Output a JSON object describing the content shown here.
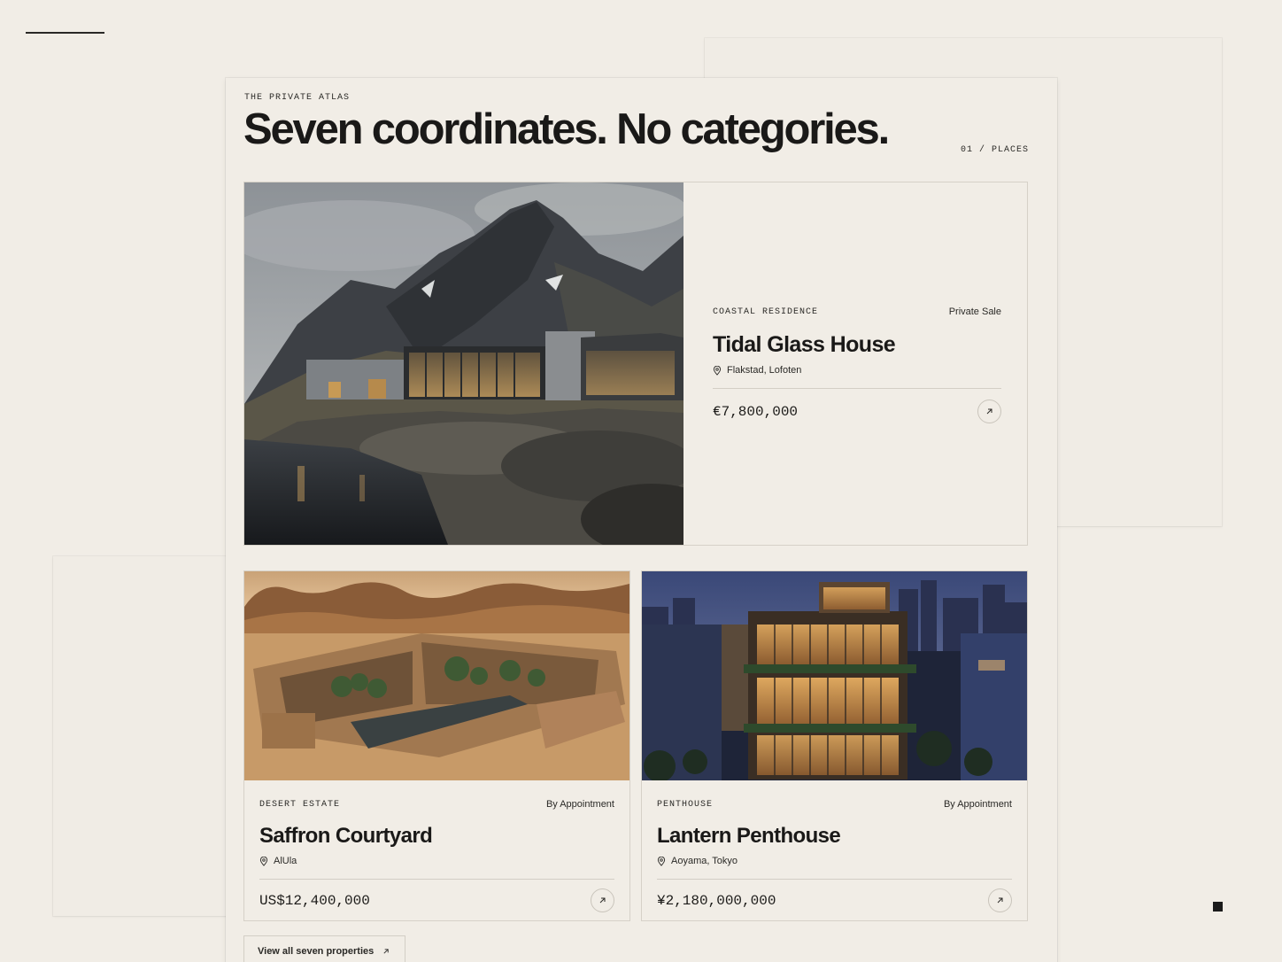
{
  "eyebrow": "THE PRIVATE ATLAS",
  "headline": "Seven coordinates. No categories.",
  "counter": "01 / PLACES",
  "featured": {
    "category": "COASTAL RESIDENCE",
    "sale": "Private Sale",
    "title": "Tidal Glass House",
    "location": "Flakstad, Lofoten",
    "price": "€7,800,000",
    "image": "coastal-glass-house-mountain-photo"
  },
  "properties": [
    {
      "category": "DESERT ESTATE",
      "sale": "By Appointment",
      "title": "Saffron Courtyard",
      "location": "AlUla",
      "price": "US$12,400,000",
      "image": "desert-courtyard-estate-photo"
    },
    {
      "category": "PENTHOUSE",
      "sale": "By Appointment",
      "title": "Lantern Penthouse",
      "location": "Aoyama, Tokyo",
      "price": "¥2,180,000,000",
      "image": "tokyo-lantern-penthouse-night-photo"
    }
  ],
  "view_all": "View all seven properties",
  "icons": {
    "location": "map-pin-icon",
    "arrow": "arrow-up-right-icon"
  },
  "colors": {
    "background": "#f1ede6",
    "ink": "#1a1918",
    "border": "#d6d1c8"
  }
}
